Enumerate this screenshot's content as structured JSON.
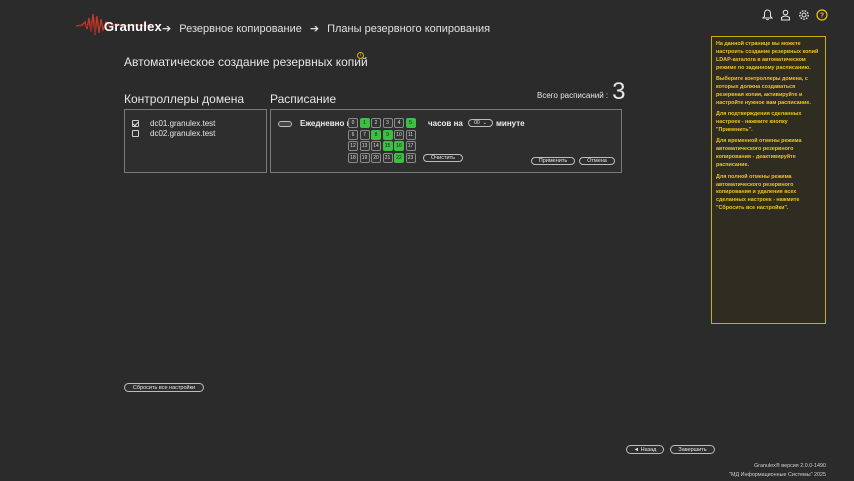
{
  "app": {
    "logo_text": "Granulex"
  },
  "breadcrumb": [
    "Резервное копирование",
    "Планы резервного копирования"
  ],
  "page_title": "Автоматическое создание резервных копий",
  "domain_controllers": {
    "title": "Контроллеры домена",
    "items": [
      {
        "name": "dc01.granulex.test",
        "checked": true
      },
      {
        "name": "dc02.granulex.test",
        "checked": false
      }
    ]
  },
  "schedule": {
    "title": "Расписание",
    "total_label": "Всего расписаний :",
    "total_value": "3",
    "daily_label": "Ежедневно в",
    "hours_label": "часов на",
    "minute_label": "минуте",
    "minute_value": "00",
    "hours": [
      {
        "label": "0",
        "on": false
      },
      {
        "label": "1",
        "on": true
      },
      {
        "label": "2",
        "on": false
      },
      {
        "label": "3",
        "on": false
      },
      {
        "label": "4",
        "on": false
      },
      {
        "label": "5",
        "on": true
      },
      {
        "label": "6",
        "on": false
      },
      {
        "label": "7",
        "on": false
      },
      {
        "label": "8",
        "on": true
      },
      {
        "label": "9",
        "on": true
      },
      {
        "label": "10",
        "on": false
      },
      {
        "label": "11",
        "on": false
      },
      {
        "label": "12",
        "on": false
      },
      {
        "label": "13",
        "on": false
      },
      {
        "label": "14",
        "on": false
      },
      {
        "label": "15",
        "on": true
      },
      {
        "label": "16",
        "on": true
      },
      {
        "label": "17",
        "on": false
      },
      {
        "label": "18",
        "on": false
      },
      {
        "label": "19",
        "on": false
      },
      {
        "label": "20",
        "on": false
      },
      {
        "label": "21",
        "on": false
      },
      {
        "label": "22",
        "on": true
      },
      {
        "label": "23",
        "on": false
      }
    ],
    "clear_label": "Очистить",
    "apply_label": "Применить",
    "cancel_label": "Отмена"
  },
  "reset_all_label": "Сбросить все настройки",
  "back_label": "◄  Назад",
  "finish_label": "Завершить",
  "help": [
    "На данной странице вы можете настроить создание резервных копий LDAP-каталога в автоматическом режиме по заданному расписанию.",
    "Выберите контроллеры домена, с которых должна создаваться резервная копия, активируйте и настройте нужное вам расписание.",
    "Для подтверждения сделанных настроек - нажмите кнопку \"Применить\".",
    "Для временной отмены режима автоматического резервного копирования - деактивируйте расписание.",
    "Для полной отмены режима автоматического резервного копирования и удаления всех сделанных настроек - нажмите \"Сбросить все настройки\"."
  ],
  "footer": {
    "version_line": "Granulex® версия 2.0.0-1490",
    "company_line": "\"МД Информационные Системы\" 2025"
  },
  "colors": {
    "accent_green": "#3cc043",
    "help_yellow": "#f0c419",
    "brand_red": "#c0392b"
  }
}
